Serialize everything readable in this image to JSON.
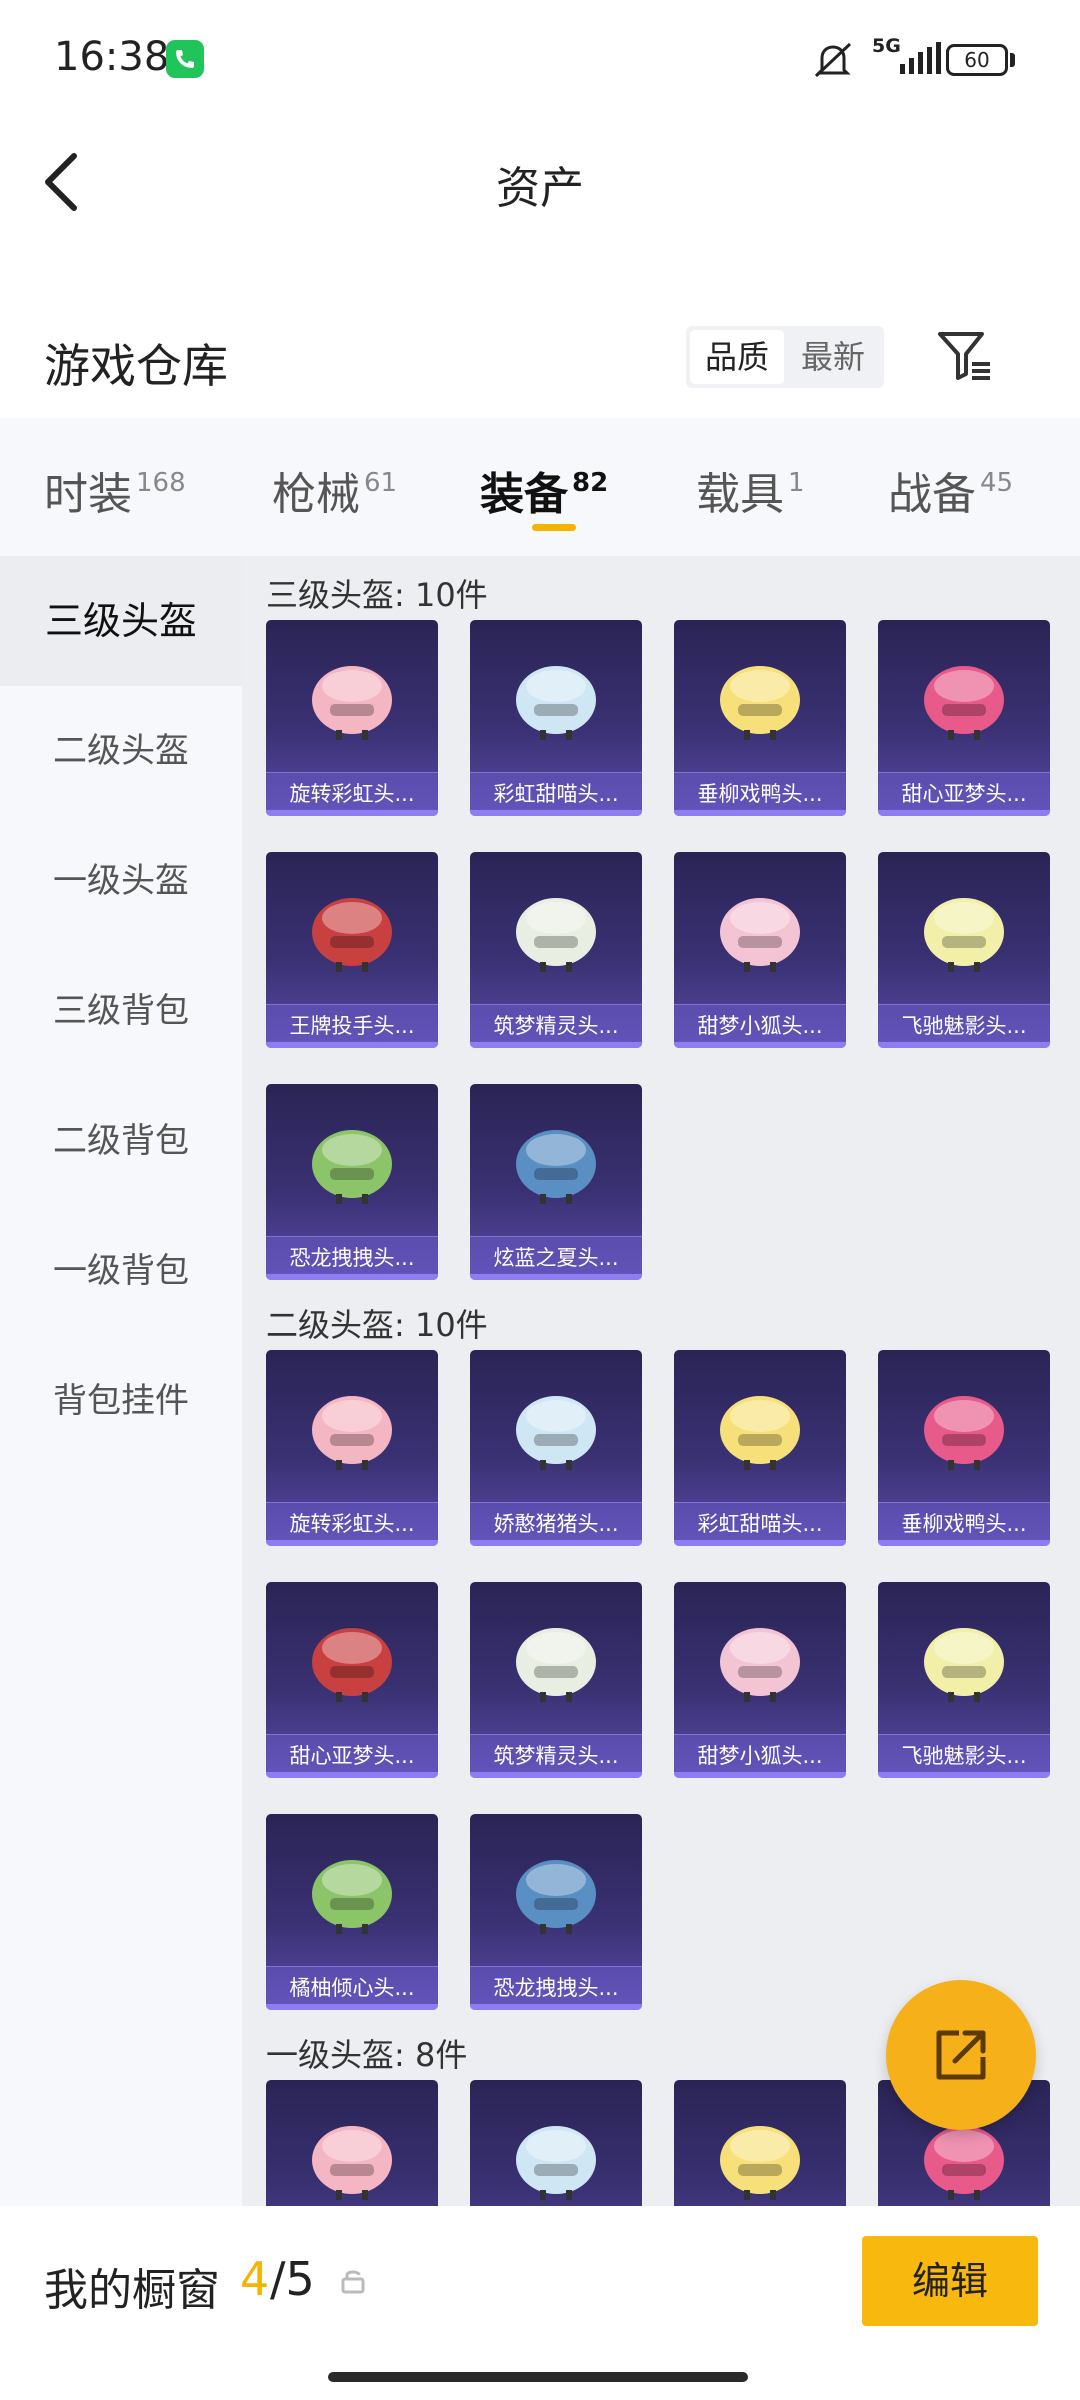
{
  "status_bar": {
    "time": "16:38",
    "network": "5G",
    "battery": "60"
  },
  "header": {
    "title": "资产"
  },
  "warehouse": {
    "title": "游戏仓库",
    "sort_options": [
      "品质",
      "最新"
    ]
  },
  "tabs": [
    {
      "label": "时装",
      "count": "168"
    },
    {
      "label": "枪械",
      "count": "61"
    },
    {
      "label": "装备",
      "count": "82"
    },
    {
      "label": "载具",
      "count": "1"
    },
    {
      "label": "战备",
      "count": "45"
    }
  ],
  "subnav": [
    "三级头盔",
    "二级头盔",
    "一级头盔",
    "三级背包",
    "二级背包",
    "一级背包",
    "背包挂件"
  ],
  "sections": [
    {
      "title": "三级头盔: 10件",
      "items": [
        "旋转彩虹头...",
        "彩虹甜喵头...",
        "垂柳戏鸭头...",
        "甜心亚梦头...",
        "王牌投手头...",
        "筑梦精灵头...",
        "甜梦小狐头...",
        "飞驰魅影头...",
        "恐龙拽拽头...",
        "炫蓝之夏头..."
      ]
    },
    {
      "title": "二级头盔: 10件",
      "items": [
        "旋转彩虹头...",
        "娇憨猪猪头...",
        "彩虹甜喵头...",
        "垂柳戏鸭头...",
        "甜心亚梦头...",
        "筑梦精灵头...",
        "甜梦小狐头...",
        "飞驰魅影头...",
        "橘柚倾心头...",
        "恐龙拽拽头..."
      ]
    },
    {
      "title": "一级头盔: 8件",
      "items": []
    }
  ],
  "bottom_bar": {
    "title": "我的橱窗",
    "count_current": "4",
    "count_rest": "/5",
    "edit_label": "编辑"
  },
  "colors": {
    "accent": "#f5b400",
    "card": "#3a3173"
  },
  "icons": [
    "phone-icon",
    "mute-icon",
    "signal-icon",
    "battery-icon",
    "back-arrow-icon",
    "filter-icon",
    "share-icon",
    "lock-icon"
  ]
}
